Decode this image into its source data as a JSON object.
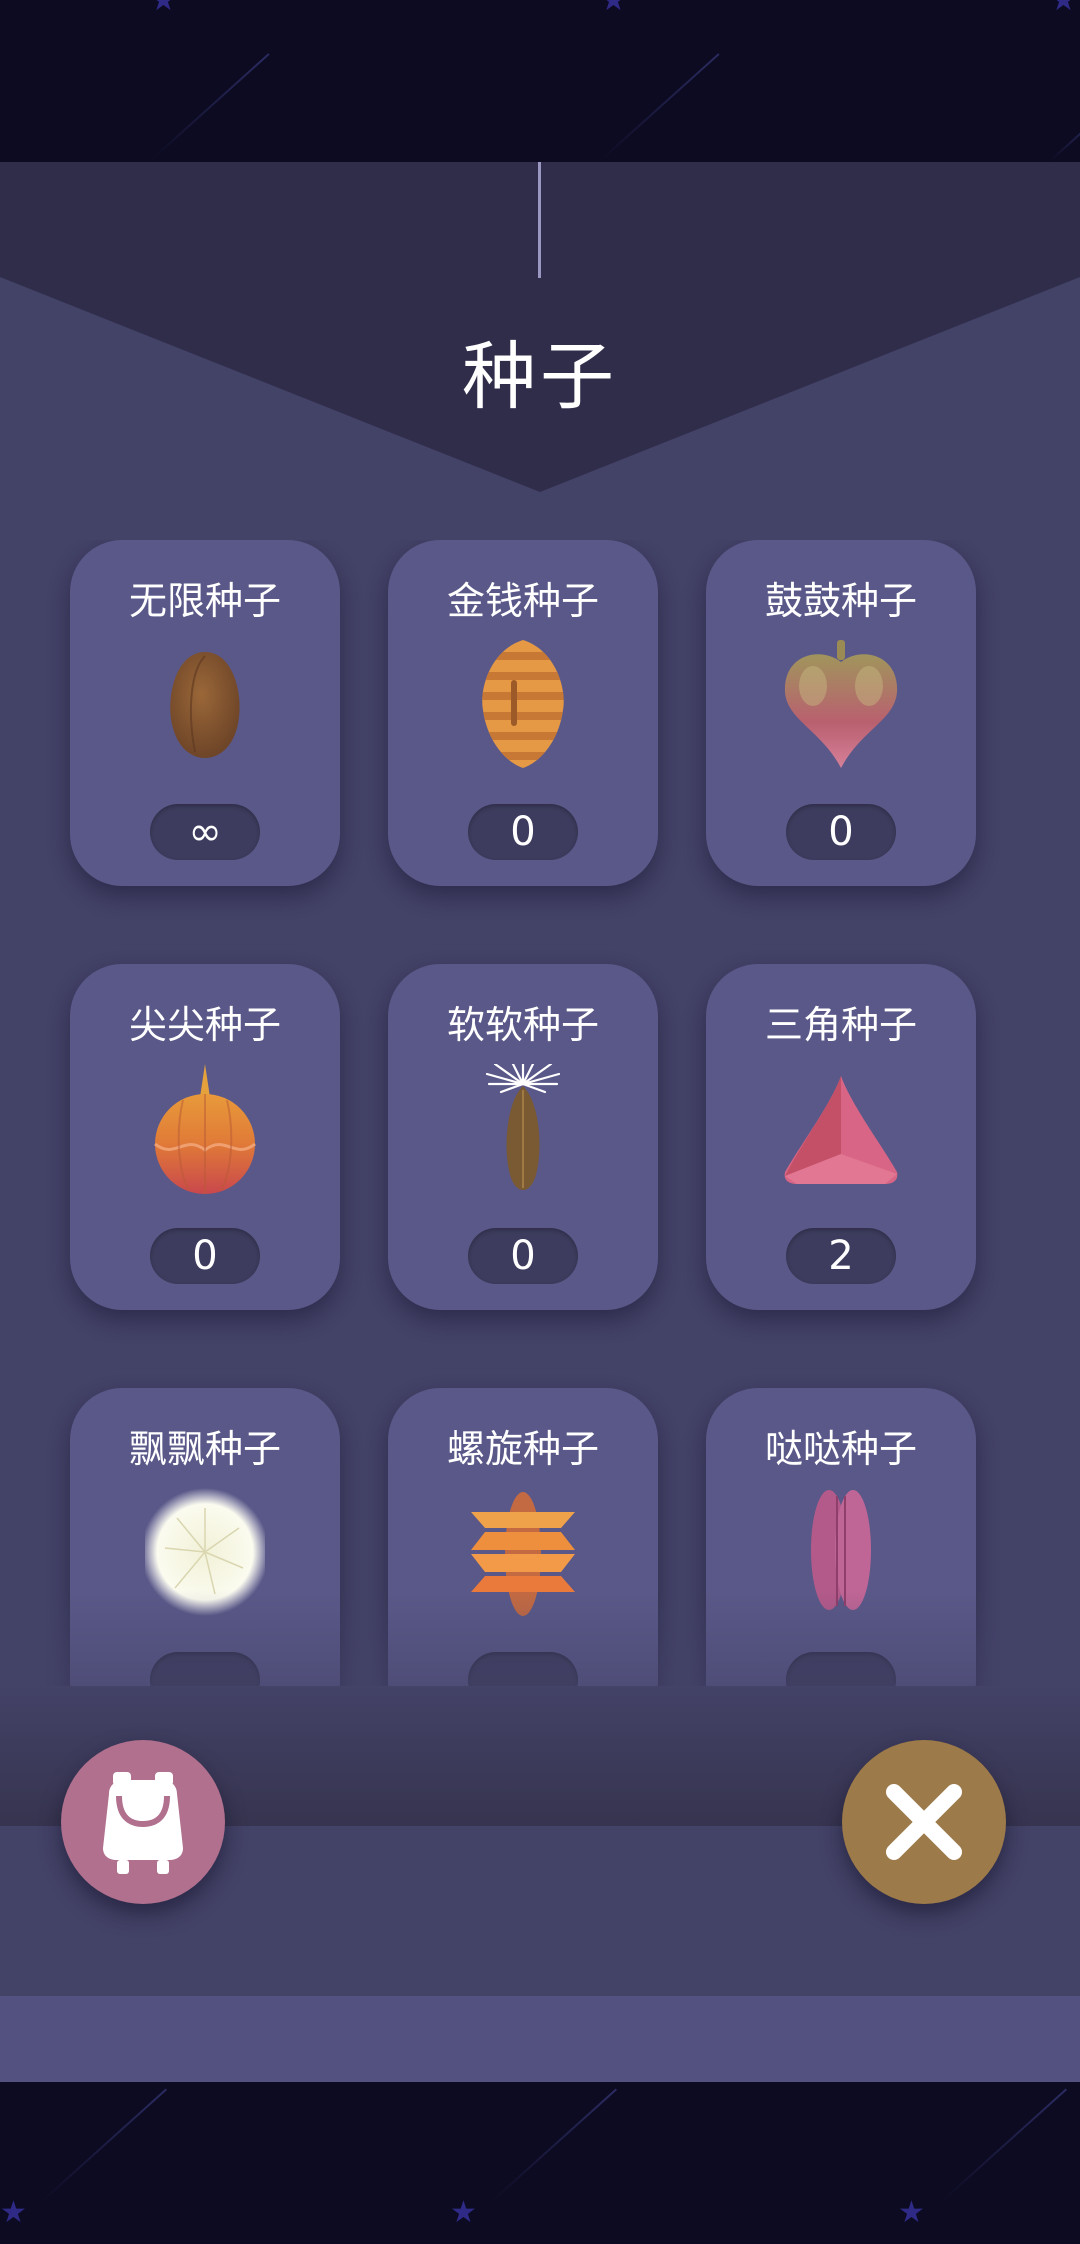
{
  "header": {
    "title": "种子"
  },
  "seeds": [
    {
      "name": "无限种子",
      "count": "∞",
      "icon": "almond-seed-icon"
    },
    {
      "name": "金钱种子",
      "count": "0",
      "icon": "striped-orange-seed-icon"
    },
    {
      "name": "鼓鼓种子",
      "count": "0",
      "icon": "puffy-heart-seed-icon"
    },
    {
      "name": "尖尖种子",
      "count": "0",
      "icon": "pointed-round-seed-icon"
    },
    {
      "name": "软软种子",
      "count": "0",
      "icon": "tufted-seed-icon"
    },
    {
      "name": "三角种子",
      "count": "2",
      "icon": "triangle-seed-icon"
    },
    {
      "name": "飘飘种子",
      "count": "",
      "icon": "dandelion-seed-icon"
    },
    {
      "name": "螺旋种子",
      "count": "",
      "icon": "spiral-seed-icon"
    },
    {
      "name": "哒哒种子",
      "count": "",
      "icon": "pink-pod-seed-icon"
    }
  ],
  "buttons": {
    "backpack": {
      "icon": "backpack-icon"
    },
    "close": {
      "icon": "close-icon"
    }
  },
  "colors": {
    "panel": "#434267",
    "card": "#5a5888",
    "backpack_button": "#b0708e",
    "close_button": "#9c7a49"
  }
}
